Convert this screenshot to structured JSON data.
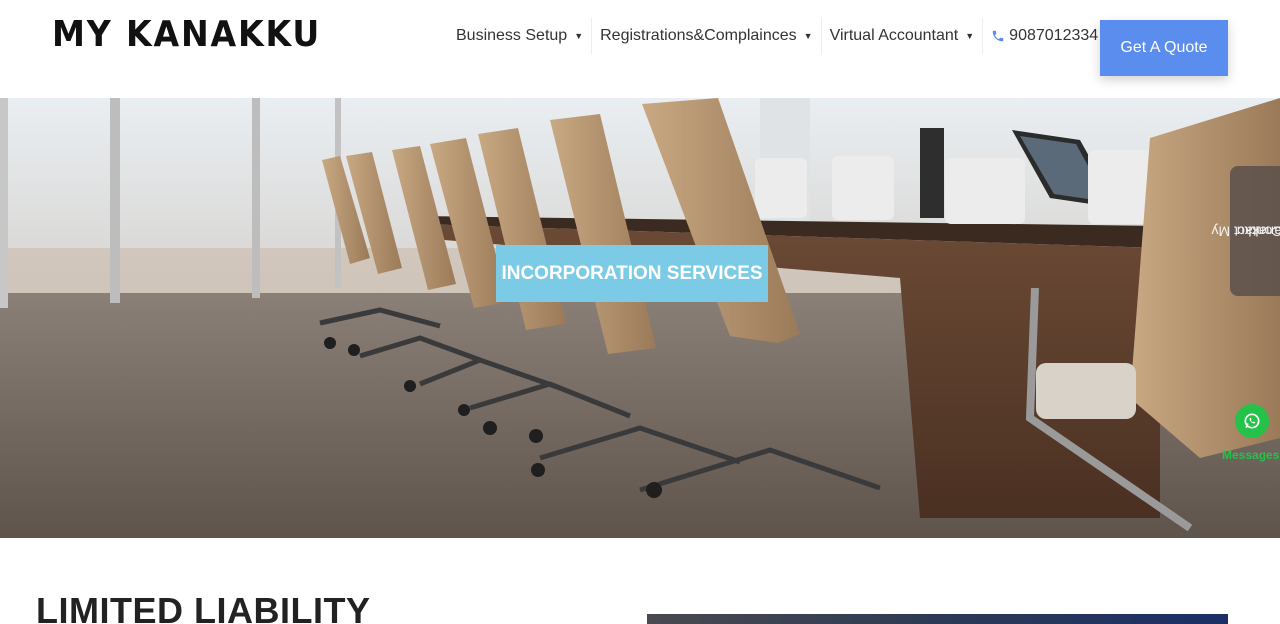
{
  "header": {
    "logo": "MY KANAKKU",
    "nav": [
      {
        "label": "Business Setup",
        "caret": "▼"
      },
      {
        "label": "Registrations&Complainces",
        "caret": "▼"
      },
      {
        "label": "Virtual Accountant",
        "caret": "▼"
      }
    ],
    "phone": "9087012334",
    "quote_button": "Get A Quote"
  },
  "hero": {
    "button": "INCORPORATION SERVICES"
  },
  "contact_tab": {
    "line1": "Contact My",
    "line2": "Kanakku"
  },
  "whatsapp": {
    "label": "Messages"
  },
  "section": {
    "title": "LIMITED LIABILITY"
  },
  "colors": {
    "accent": "#5b8dee",
    "hero_button": "#7ccbe6",
    "whatsapp": "#25c24a"
  }
}
